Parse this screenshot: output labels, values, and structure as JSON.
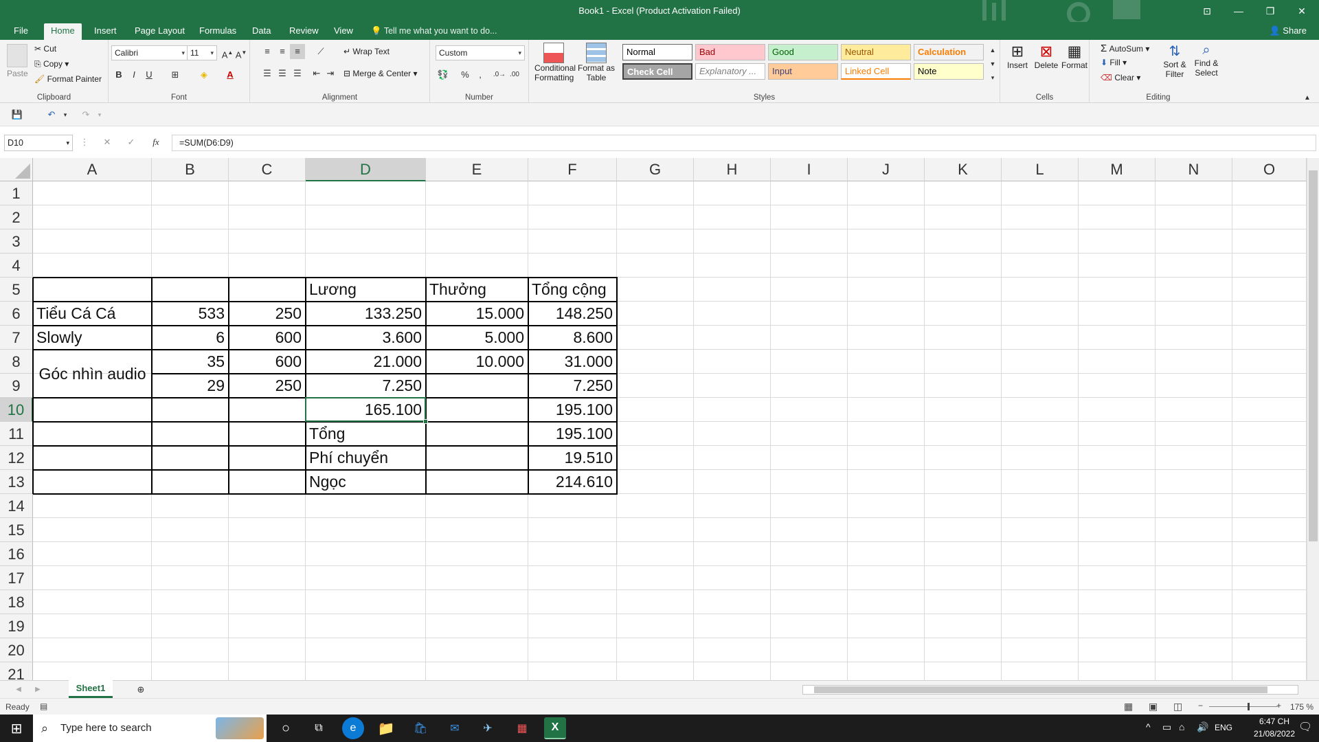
{
  "window": {
    "title": "Book1 - Excel (Product Activation Failed)"
  },
  "tabs": [
    "File",
    "Home",
    "Insert",
    "Page Layout",
    "Formulas",
    "Data",
    "Review",
    "View"
  ],
  "tell_me": "Tell me what you want to do...",
  "share": "Share",
  "ribbon": {
    "clipboard": {
      "paste": "Paste",
      "cut": "Cut",
      "copy": "Copy",
      "format_painter": "Format Painter",
      "label": "Clipboard"
    },
    "font": {
      "name": "Calibri",
      "size": "11",
      "bold": "B",
      "italic": "I",
      "underline": "U",
      "label": "Font"
    },
    "alignment": {
      "wrap_text": "Wrap Text",
      "merge_center": "Merge & Center",
      "label": "Alignment"
    },
    "number": {
      "format": "Custom",
      "percent": "%",
      "comma": ",",
      "label": "Number"
    },
    "styles": {
      "conditional_formatting_1": "Conditional",
      "conditional_formatting_2": "Formatting",
      "format_as_table_1": "Format as",
      "format_as_table_2": "Table",
      "cells": [
        {
          "label": "Normal",
          "bg": "#ffffff",
          "color": "#000000"
        },
        {
          "label": "Bad",
          "bg": "#ffc7ce",
          "color": "#9c0006"
        },
        {
          "label": "Good",
          "bg": "#c6efce",
          "color": "#006100"
        },
        {
          "label": "Neutral",
          "bg": "#ffeb9c",
          "color": "#9c5700"
        },
        {
          "label": "Calculation",
          "bg": "#f2f2f2",
          "color": "#fa7d00"
        },
        {
          "label": "Check Cell",
          "bg": "#a5a5a5",
          "color": "#ffffff"
        },
        {
          "label": "Explanatory ...",
          "bg": "#ffffff",
          "color": "#7f7f7f"
        },
        {
          "label": "Input",
          "bg": "#ffcc99",
          "color": "#3f3f76"
        },
        {
          "label": "Linked Cell",
          "bg": "#ffffff",
          "color": "#fa7d00"
        },
        {
          "label": "Note",
          "bg": "#ffffcc",
          "color": "#000000"
        }
      ],
      "label": "Styles"
    },
    "cells": {
      "insert": "Insert",
      "delete": "Delete",
      "format": "Format",
      "label": "Cells"
    },
    "editing": {
      "autosum": "AutoSum",
      "fill": "Fill",
      "clear": "Clear",
      "sort_filter_1": "Sort &",
      "sort_filter_2": "Filter",
      "find_select_1": "Find &",
      "find_select_2": "Select",
      "label": "Editing"
    }
  },
  "formula_bar": {
    "name_box": "D10",
    "fx": "fx",
    "formula": "=SUM(D6:D9)"
  },
  "columns": [
    "A",
    "B",
    "C",
    "D",
    "E",
    "F",
    "G",
    "H",
    "I",
    "J",
    "K",
    "L",
    "M",
    "N",
    "O"
  ],
  "rows": [
    "1",
    "2",
    "3",
    "4",
    "5",
    "6",
    "7",
    "8",
    "9",
    "10",
    "11",
    "12",
    "13",
    "14",
    "15",
    "16",
    "17",
    "18",
    "19",
    "20",
    "21"
  ],
  "cells": {
    "D5": "Lương",
    "E5": "Thưởng",
    "F5": "Tổng cộng",
    "A6": "Tiểu Cá Cá",
    "B6": "533",
    "C6": "250",
    "D6": "133.250",
    "E6": "15.000",
    "F6": "148.250",
    "A7": "Slowly",
    "B7": "6",
    "C7": "600",
    "D7": "3.600",
    "E7": "5.000",
    "F7": "8.600",
    "A8": "Góc nhìn audio",
    "B8": "35",
    "C8": "600",
    "D8": "21.000",
    "E8": "10.000",
    "F8": "31.000",
    "B9": "29",
    "C9": "250",
    "D9": "7.250",
    "F9": "7.250",
    "D10": "165.100",
    "F10": "195.100",
    "D11": "Tổng",
    "F11": "195.100",
    "D12": "Phí chuyển",
    "F12": "19.510",
    "D13": "Ngọc",
    "F13": "214.610"
  },
  "sheet_tab": "Sheet1",
  "status": {
    "ready": "Ready",
    "zoom": "175 %"
  },
  "taskbar": {
    "search": "Type here to search",
    "lang": "ENG",
    "time": "6:47 CH",
    "date": "21/08/2022"
  },
  "colors": {
    "excel_green": "#217346"
  }
}
